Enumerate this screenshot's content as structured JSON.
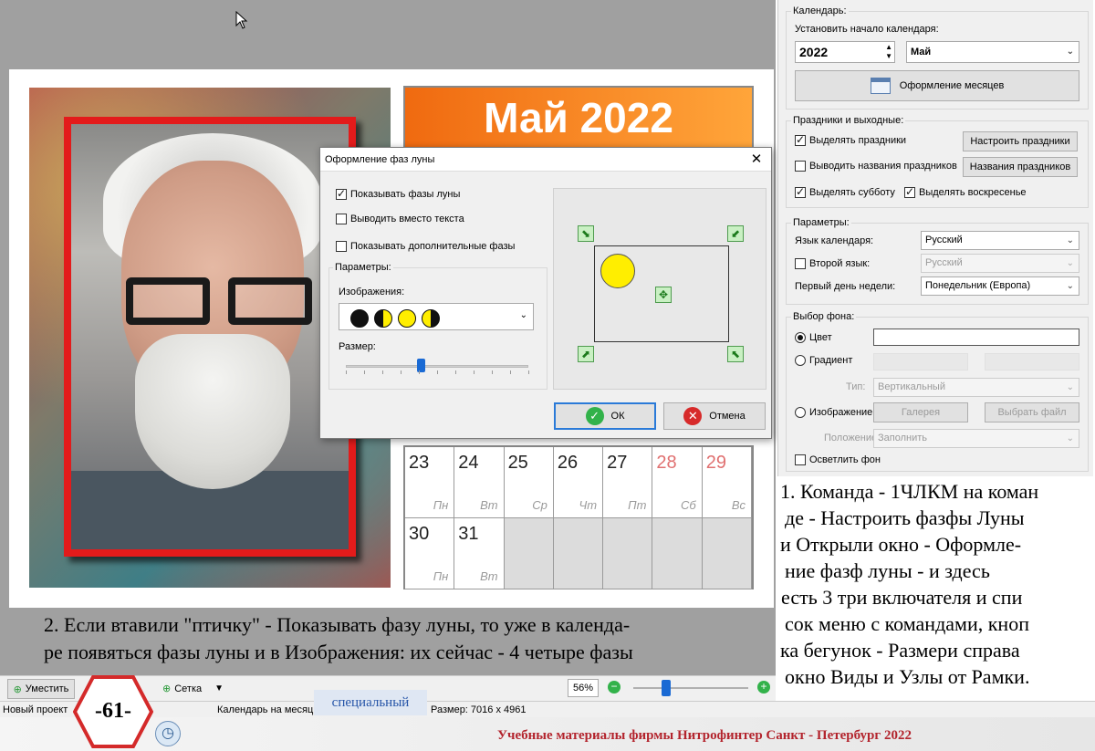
{
  "calendar_preview": {
    "title": "Май 2022",
    "rows": [
      [
        {
          "num": "23",
          "dow": "Пн"
        },
        {
          "num": "24",
          "dow": "Вт"
        },
        {
          "num": "25",
          "dow": "Ср"
        },
        {
          "num": "26",
          "dow": "Чт"
        },
        {
          "num": "27",
          "dow": "Пт"
        },
        {
          "num": "28",
          "dow": "Сб",
          "weekend": true
        },
        {
          "num": "29",
          "dow": "Вс",
          "weekend": true
        }
      ],
      [
        {
          "num": "30",
          "dow": "Пн"
        },
        {
          "num": "31",
          "dow": "Вт"
        },
        {
          "empty": true
        },
        {
          "empty": true
        },
        {
          "empty": true
        },
        {
          "empty": true
        },
        {
          "empty": true
        }
      ]
    ]
  },
  "dialog": {
    "title": "Оформление фаз луны",
    "close": "✕",
    "show_phases": "Показывать фазы луны",
    "instead_of_text": "Выводить вместо текста",
    "extra_phases": "Показывать дополнительные фазы",
    "params_label": "Параметры:",
    "images_label": "Изображения:",
    "size_label": "Размер:",
    "size_value": 0.5,
    "ok": "ОК",
    "cancel": "Отмена"
  },
  "right_panel": {
    "calendar_group": "Календарь:",
    "set_start": "Установить начало календаря:",
    "year": "2022",
    "month": "Май",
    "months_design": "Оформление месяцев",
    "holidays_group": "Праздники и выходные:",
    "highlight_holidays": "Выделять праздники",
    "setup_holidays": "Настроить праздники",
    "show_holiday_names": "Выводить названия праздников",
    "holiday_names": "Названия праздников",
    "highlight_saturday": "Выделять субботу",
    "highlight_sunday": "Выделять воскресенье",
    "params_group": "Параметры:",
    "calendar_language": "Язык календаря:",
    "language_value": "Русский",
    "second_language": "Второй язык:",
    "second_language_value": "Русский",
    "first_day": "Первый день недели:",
    "first_day_value": "Понедельник (Европа)",
    "background_group": "Выбор фона:",
    "color": "Цвет",
    "gradient": "Градиент",
    "type_label": "Тип:",
    "type_value": "Вертикальный",
    "image": "Изображение",
    "gallery": "Галерея",
    "choose_file": "Выбрать файл",
    "position_label": "Положение:",
    "position_value": "Заполнить",
    "lighten_bg": "Осветлить фон"
  },
  "toolbar": {
    "fit": "Уместить",
    "grid": "Сетка",
    "zoom": "56%"
  },
  "statusbar": {
    "project": "Новый проект",
    "calendar_type": "Календарь на месяц",
    "size": "Размер: 7016 x 4961"
  },
  "annotations": {
    "right_lines": [
      "1. Команда - 1ЧЛКМ на коман",
      "де - Настроить фазфы Луны",
      "и Открыли окно - Оформле-",
      "ние фазф луны - и здесь",
      "есть 3 три включателя и спи",
      "сок меню с командами, кноп",
      "ка бегунок - Размери справа",
      "окно Виды и Узлы от Рамки."
    ],
    "bottom_lines": [
      "2. Если втавили \"птичку\" - Показывать фазу луны, то уже в календа-",
      "ре появяться фазы луны и в Изображения: их сейчас - 4 четыре фазы"
    ],
    "badge": "-61-",
    "special": "специальный",
    "footer": "Учебные материалы фирмы Нитрофинтер  Санкт - Петербург  2022"
  }
}
